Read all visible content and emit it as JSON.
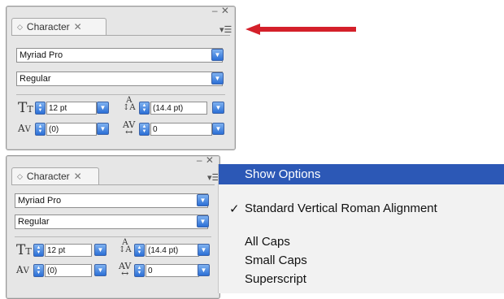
{
  "panel_top": {
    "tab_title": "Character",
    "font_family": "Myriad Pro",
    "font_style": "Regular",
    "font_size": "12 pt",
    "leading": "(14.4 pt)",
    "kerning": "(0)",
    "tracking": "0"
  },
  "panel_bottom": {
    "tab_title": "Character",
    "font_family": "Myriad Pro",
    "font_style": "Regular",
    "font_size": "12 pt",
    "leading": "(14.4 pt)",
    "kerning": "(0)",
    "tracking": "0"
  },
  "menu": {
    "highlighted": "Show Options",
    "checked_item": "Standard Vertical Roman Alignment",
    "items": [
      "All Caps",
      "Small Caps",
      "Superscript"
    ]
  },
  "colors": {
    "arrow": "#d4202a",
    "menu_highlight": "#2c58b6"
  }
}
